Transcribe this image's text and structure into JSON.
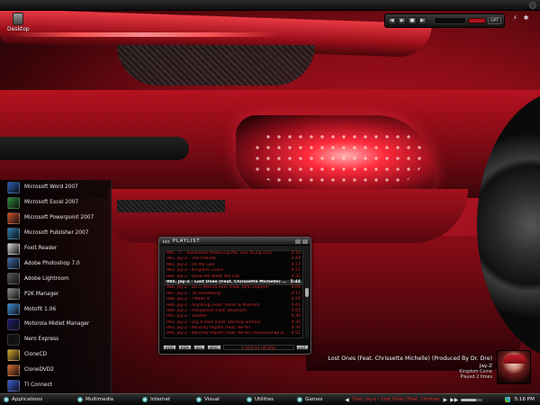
{
  "desktop": {
    "label": "Desktop"
  },
  "launcher": {
    "items": [
      {
        "label": "Microsoft Word 2007",
        "icon": "word-icon",
        "color": "#2a5bb8"
      },
      {
        "label": "Microsoft Excel 2007",
        "icon": "excel-icon",
        "color": "#2a8a3a"
      },
      {
        "label": "Microsoft Powerpoint 2007",
        "icon": "powerpoint-icon",
        "color": "#d0502a"
      },
      {
        "label": "Microsoft Publisher 2007",
        "icon": "publisher-icon",
        "color": "#2a7ab0"
      },
      {
        "label": "Foxit Reader",
        "icon": "foxit-reader-icon",
        "color": "#d8d8d8"
      },
      {
        "label": "Adobe Photoshop 7.0",
        "icon": "photoshop-icon",
        "color": "#3a6aa8"
      },
      {
        "label": "Adobe Lightroom",
        "icon": "lightroom-icon",
        "color": "#555555"
      },
      {
        "label": "P2K Manager",
        "icon": "p2k-manager-icon",
        "color": "#8a8a8a"
      },
      {
        "label": "Motofit 1.06",
        "icon": "motofit-icon",
        "color": "#3a8ad8"
      },
      {
        "label": "Motorola Midlet Manager",
        "icon": "motorola-icon",
        "color": "#1a1a6a"
      },
      {
        "label": "Nero Express",
        "icon": "nero-icon",
        "color": "#111111"
      },
      {
        "label": "CloneCD",
        "icon": "clonecd-icon",
        "color": "#d8a82a"
      },
      {
        "label": "CloneDVD2",
        "icon": "clonedvd-icon",
        "color": "#d86a2a"
      },
      {
        "label": "TI Connect",
        "icon": "ti-connect-icon",
        "color": "#3a5ad8"
      }
    ]
  },
  "playlist": {
    "title": "PLAYLIST",
    "tracks": [
      {
        "name": "980. T.I. - Bankhead (featuring P$C and Young Dro)",
        "duration": "4:16"
      },
      {
        "name": "981. Jay-Z - The Prelude",
        "duration": "3:44"
      },
      {
        "name": "982. Jay-Z - Oh My God",
        "duration": "4:17"
      },
      {
        "name": "983. Jay-Z - Kingdom Come",
        "duration": "4:21"
      },
      {
        "name": "984. Jay-Z - Show Me What You Got",
        "duration": "4:35"
      },
      {
        "name": "985. Jay-Z - Lost Ones (Feat. Chrissette Michelle) (Produ...",
        "duration": "5:44"
      },
      {
        "name": "986. Jay-Z - Do U Wanna Ride (Feat. John Legend)",
        "duration": "5:09"
      },
      {
        "name": "987. Jay-Z - 30 Something",
        "duration": "4:13"
      },
      {
        "name": "988. Jay-Z - I Made It",
        "duration": "4:20"
      },
      {
        "name": "989. Jay-Z - Anything (Feat. Usher & Pharrell)",
        "duration": "3:41"
      },
      {
        "name": "990. Jay-Z - Hollywood (Feat. Beyonce)",
        "duration": "5:05"
      },
      {
        "name": "991. Jay-Z - Trouble",
        "duration": "4:36"
      },
      {
        "name": "992. Jay-Z - Dig A Hole (Feat. Sterling Simms)",
        "duration": "4:35"
      },
      {
        "name": "993. Jay-Z - Minority Report (Feat. Ne-Yo)",
        "duration": "4:36"
      },
      {
        "name": "994. Jay-Z - Minority Report (Feat. Ne-Yo) (Produced By D...",
        "duration": "4:51"
      }
    ],
    "active_index": 5,
    "buttons": {
      "add": "ADD",
      "rem": "REM",
      "sel": "SEL",
      "misc": "MISC",
      "list": "LIST"
    },
    "time_display": "1:35/5:44 (45.8%)"
  },
  "now_playing": {
    "title": "Lost Ones (Feat. Chrissette Michelle) (Produced By Dr. Dre)",
    "artist": "Jay-Z",
    "album": "Kingdom Come",
    "played": "Played 2 times"
  },
  "taskbar": {
    "menus": [
      "Applications",
      "Multimedia",
      "Internet",
      "Visual",
      "Utilities",
      "Games"
    ],
    "track_label": "Dre)",
    "track_text": "Jay-z - Lost Ones (Feat. Chrisset",
    "clock": "5:16 PM"
  },
  "colors": {
    "accent": "#d42a2a",
    "bg_dark": "#0a0a0a"
  }
}
